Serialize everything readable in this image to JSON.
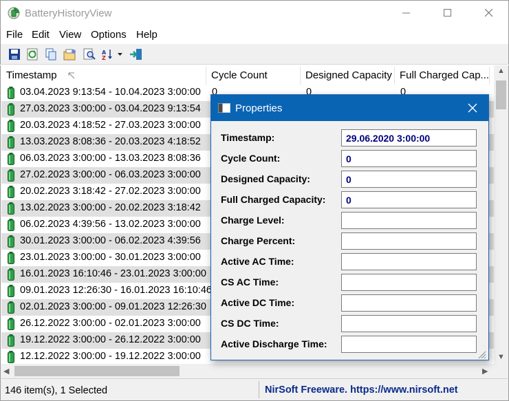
{
  "window": {
    "title": "BatteryHistoryView"
  },
  "menu": [
    "File",
    "Edit",
    "View",
    "Options",
    "Help"
  ],
  "toolbar": {
    "icons": [
      "save-icon",
      "refresh-icon",
      "copy-icon",
      "properties-icon",
      "find-icon",
      "sort-icon",
      "exit-icon"
    ]
  },
  "columns": [
    "Timestamp",
    "Cycle Count",
    "Designed Capacity",
    "Full Charged Cap..."
  ],
  "rows": [
    "03.04.2023 9:13:54 - 10.04.2023 3:00:00",
    "27.03.2023 3:00:00 - 03.04.2023 9:13:54",
    "20.03.2023 4:18:52 - 27.03.2023 3:00:00",
    "13.03.2023 8:08:36 - 20.03.2023 4:18:52",
    "06.03.2023 3:00:00 - 13.03.2023 8:08:36",
    "27.02.2023 3:00:00 - 06.03.2023 3:00:00",
    "20.02.2023 3:18:42 - 27.02.2023 3:00:00",
    "13.02.2023 3:00:00 - 20.02.2023 3:18:42",
    "06.02.2023 4:39:56 - 13.02.2023 3:00:00",
    "30.01.2023 3:00:00 - 06.02.2023 4:39:56",
    "23.01.2023 3:00:00 - 30.01.2023 3:00:00",
    "16.01.2023 16:10:46 - 23.01.2023 3:00:00",
    "09.01.2023 12:26:30 - 16.01.2023 16:10:46",
    "02.01.2023 3:00:00 - 09.01.2023 12:26:30",
    "26.12.2022 3:00:00 - 02.01.2023 3:00:00",
    "19.12.2022 3:00:00 - 26.12.2022 3:00:00",
    "12.12.2022 3:00:00 - 19.12.2022 3:00:00"
  ],
  "first_row_values": [
    "0",
    "0",
    "0"
  ],
  "status": {
    "items": "146 item(s), 1 Selected",
    "credit": "NirSoft Freeware. https://www.nirsoft.net"
  },
  "dialog": {
    "title": "Properties",
    "fields": [
      {
        "label": "Timestamp:",
        "value": "29.06.2020 3:00:00"
      },
      {
        "label": "Cycle Count:",
        "value": "0"
      },
      {
        "label": "Designed Capacity:",
        "value": "0"
      },
      {
        "label": "Full Charged Capacity:",
        "value": "0"
      },
      {
        "label": "Charge Level:",
        "value": ""
      },
      {
        "label": "Charge Percent:",
        "value": ""
      },
      {
        "label": "Active AC Time:",
        "value": ""
      },
      {
        "label": "CS AC Time:",
        "value": ""
      },
      {
        "label": "Active DC Time:",
        "value": ""
      },
      {
        "label": "CS DC Time:",
        "value": ""
      },
      {
        "label": "Active Discharge Time:",
        "value": ""
      }
    ]
  },
  "colors": {
    "accent": "#0a64b4",
    "battery": "#1f8a3a",
    "selected_row": "#e0e0e0",
    "field_text": "#00007e"
  }
}
